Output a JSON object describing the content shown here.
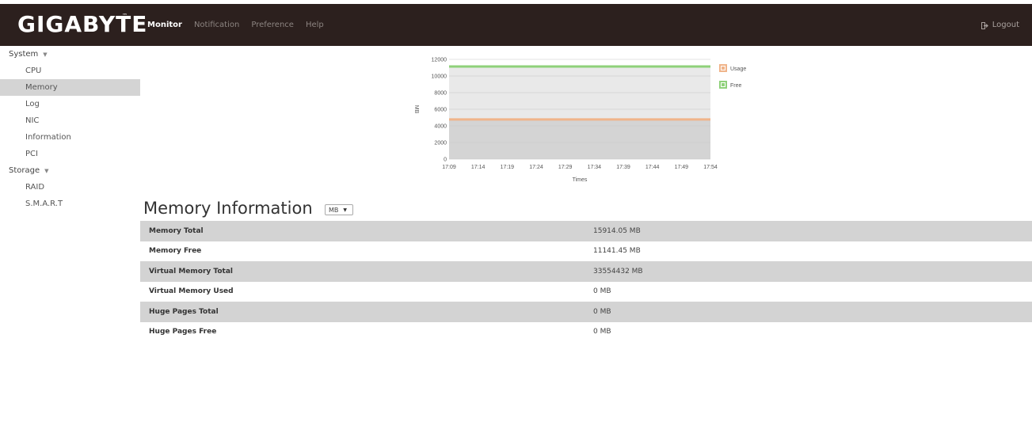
{
  "header": {
    "logo": "GIGABYTE",
    "logo_tm": "™",
    "nav": [
      "Monitor",
      "Notification",
      "Preference",
      "Help"
    ],
    "active_nav": "Monitor",
    "logout_label": "Logout"
  },
  "sidebar": {
    "sections": [
      {
        "label": "System",
        "items": [
          "CPU",
          "Memory",
          "Log",
          "NIC",
          "Information",
          "PCI"
        ]
      },
      {
        "label": "Storage",
        "items": [
          "RAID",
          "S.M.A.R.T"
        ]
      }
    ],
    "active_item": "Memory"
  },
  "chart_data": {
    "type": "line",
    "ylabel": "MB",
    "xlabel": "Times",
    "x": [
      "17:09",
      "17:14",
      "17:19",
      "17:24",
      "17:29",
      "17:34",
      "17:39",
      "17:44",
      "17:49",
      "17:54"
    ],
    "ylim": [
      0,
      12000
    ],
    "yticks": [
      0,
      2000,
      4000,
      6000,
      8000,
      10000,
      12000
    ],
    "series": [
      {
        "name": "Usage",
        "color": "#f0b48a",
        "values": [
          4773,
          4773,
          4773,
          4773,
          4773,
          4773,
          4773,
          4773,
          4773,
          4773
        ]
      },
      {
        "name": "Free",
        "color": "#8fd17a",
        "values": [
          11141,
          11141,
          11141,
          11141,
          11141,
          11141,
          11141,
          11141,
          11141,
          11141
        ]
      }
    ],
    "legend_position": "right",
    "grid": true
  },
  "memory": {
    "title": "Memory Information",
    "unit_selected": "MB",
    "rows": [
      {
        "label": "Memory Total",
        "value": "15914.05 MB"
      },
      {
        "label": "Memory Free",
        "value": "11141.45 MB"
      },
      {
        "label": "Virtual Memory Total",
        "value": "33554432 MB"
      },
      {
        "label": "Virtual Memory Used",
        "value": "0 MB"
      },
      {
        "label": "Huge Pages Total",
        "value": "0 MB"
      },
      {
        "label": "Huge Pages Free",
        "value": "0 MB"
      }
    ]
  }
}
